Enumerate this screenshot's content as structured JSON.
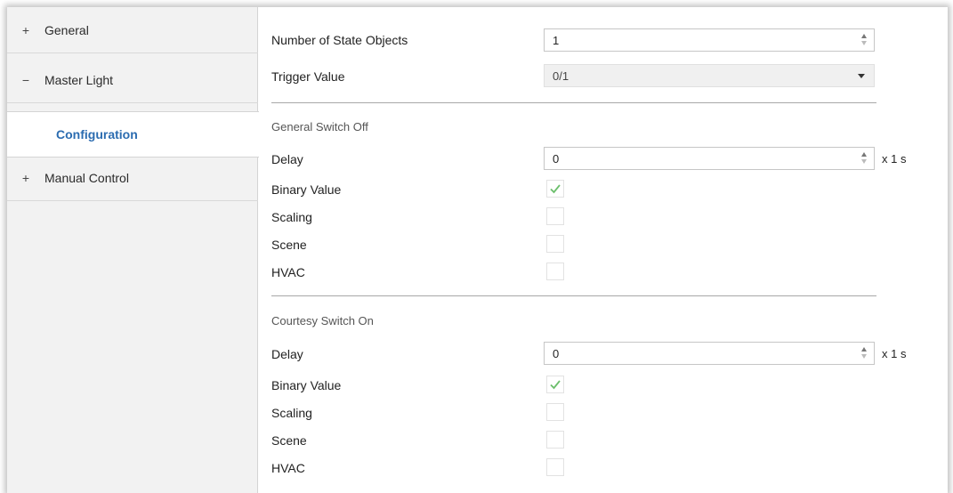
{
  "sidebar": {
    "items": [
      {
        "sign": "+",
        "label": "General"
      },
      {
        "sign": "−",
        "label": "Master Light"
      },
      {
        "label": "Configuration"
      },
      {
        "sign": "+",
        "label": "Manual Control"
      }
    ]
  },
  "settings": {
    "state_objects": {
      "label": "Number of State Objects",
      "value": "1"
    },
    "trigger": {
      "label": "Trigger Value",
      "value": "0/1"
    }
  },
  "general_switch_off": {
    "title": "General Switch Off",
    "delay": {
      "label": "Delay",
      "value": "0",
      "unit": "x 1 s"
    },
    "binary_value": {
      "label": "Binary Value",
      "checked": true
    },
    "scaling": {
      "label": "Scaling",
      "checked": false
    },
    "scene": {
      "label": "Scene",
      "checked": false
    },
    "hvac": {
      "label": "HVAC",
      "checked": false
    }
  },
  "courtesy_switch_on": {
    "title": "Courtesy Switch On",
    "delay": {
      "label": "Delay",
      "value": "0",
      "unit": "x 1 s"
    },
    "binary_value": {
      "label": "Binary Value",
      "checked": true
    },
    "scaling": {
      "label": "Scaling",
      "checked": false
    },
    "scene": {
      "label": "Scene",
      "checked": false
    },
    "hvac": {
      "label": "HVAC",
      "checked": false
    }
  },
  "colors": {
    "selected_text": "#2b6cb0",
    "check_mark": "#6cbf6c",
    "sidebar_bg": "#f2f2f2"
  }
}
